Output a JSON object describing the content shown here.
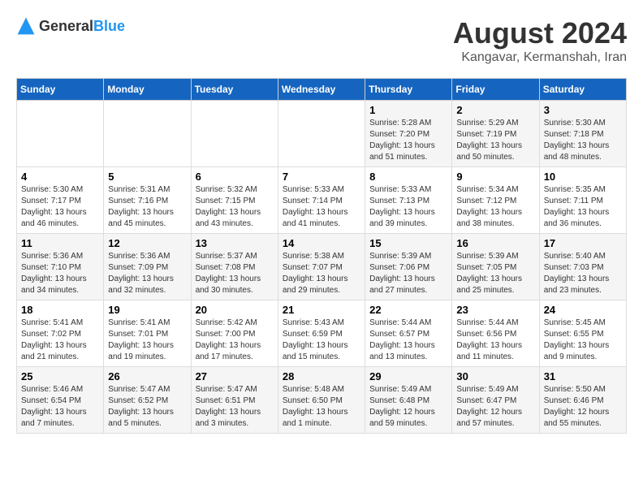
{
  "header": {
    "logo_general": "General",
    "logo_blue": "Blue",
    "title": "August 2024",
    "subtitle": "Kangavar, Kermanshah, Iran"
  },
  "weekdays": [
    "Sunday",
    "Monday",
    "Tuesday",
    "Wednesday",
    "Thursday",
    "Friday",
    "Saturday"
  ],
  "weeks": [
    [
      {
        "day": "",
        "content": ""
      },
      {
        "day": "",
        "content": ""
      },
      {
        "day": "",
        "content": ""
      },
      {
        "day": "",
        "content": ""
      },
      {
        "day": "1",
        "content": "Sunrise: 5:28 AM\nSunset: 7:20 PM\nDaylight: 13 hours and 51 minutes."
      },
      {
        "day": "2",
        "content": "Sunrise: 5:29 AM\nSunset: 7:19 PM\nDaylight: 13 hours and 50 minutes."
      },
      {
        "day": "3",
        "content": "Sunrise: 5:30 AM\nSunset: 7:18 PM\nDaylight: 13 hours and 48 minutes."
      }
    ],
    [
      {
        "day": "4",
        "content": "Sunrise: 5:30 AM\nSunset: 7:17 PM\nDaylight: 13 hours and 46 minutes."
      },
      {
        "day": "5",
        "content": "Sunrise: 5:31 AM\nSunset: 7:16 PM\nDaylight: 13 hours and 45 minutes."
      },
      {
        "day": "6",
        "content": "Sunrise: 5:32 AM\nSunset: 7:15 PM\nDaylight: 13 hours and 43 minutes."
      },
      {
        "day": "7",
        "content": "Sunrise: 5:33 AM\nSunset: 7:14 PM\nDaylight: 13 hours and 41 minutes."
      },
      {
        "day": "8",
        "content": "Sunrise: 5:33 AM\nSunset: 7:13 PM\nDaylight: 13 hours and 39 minutes."
      },
      {
        "day": "9",
        "content": "Sunrise: 5:34 AM\nSunset: 7:12 PM\nDaylight: 13 hours and 38 minutes."
      },
      {
        "day": "10",
        "content": "Sunrise: 5:35 AM\nSunset: 7:11 PM\nDaylight: 13 hours and 36 minutes."
      }
    ],
    [
      {
        "day": "11",
        "content": "Sunrise: 5:36 AM\nSunset: 7:10 PM\nDaylight: 13 hours and 34 minutes."
      },
      {
        "day": "12",
        "content": "Sunrise: 5:36 AM\nSunset: 7:09 PM\nDaylight: 13 hours and 32 minutes."
      },
      {
        "day": "13",
        "content": "Sunrise: 5:37 AM\nSunset: 7:08 PM\nDaylight: 13 hours and 30 minutes."
      },
      {
        "day": "14",
        "content": "Sunrise: 5:38 AM\nSunset: 7:07 PM\nDaylight: 13 hours and 29 minutes."
      },
      {
        "day": "15",
        "content": "Sunrise: 5:39 AM\nSunset: 7:06 PM\nDaylight: 13 hours and 27 minutes."
      },
      {
        "day": "16",
        "content": "Sunrise: 5:39 AM\nSunset: 7:05 PM\nDaylight: 13 hours and 25 minutes."
      },
      {
        "day": "17",
        "content": "Sunrise: 5:40 AM\nSunset: 7:03 PM\nDaylight: 13 hours and 23 minutes."
      }
    ],
    [
      {
        "day": "18",
        "content": "Sunrise: 5:41 AM\nSunset: 7:02 PM\nDaylight: 13 hours and 21 minutes."
      },
      {
        "day": "19",
        "content": "Sunrise: 5:41 AM\nSunset: 7:01 PM\nDaylight: 13 hours and 19 minutes."
      },
      {
        "day": "20",
        "content": "Sunrise: 5:42 AM\nSunset: 7:00 PM\nDaylight: 13 hours and 17 minutes."
      },
      {
        "day": "21",
        "content": "Sunrise: 5:43 AM\nSunset: 6:59 PM\nDaylight: 13 hours and 15 minutes."
      },
      {
        "day": "22",
        "content": "Sunrise: 5:44 AM\nSunset: 6:57 PM\nDaylight: 13 hours and 13 minutes."
      },
      {
        "day": "23",
        "content": "Sunrise: 5:44 AM\nSunset: 6:56 PM\nDaylight: 13 hours and 11 minutes."
      },
      {
        "day": "24",
        "content": "Sunrise: 5:45 AM\nSunset: 6:55 PM\nDaylight: 13 hours and 9 minutes."
      }
    ],
    [
      {
        "day": "25",
        "content": "Sunrise: 5:46 AM\nSunset: 6:54 PM\nDaylight: 13 hours and 7 minutes."
      },
      {
        "day": "26",
        "content": "Sunrise: 5:47 AM\nSunset: 6:52 PM\nDaylight: 13 hours and 5 minutes."
      },
      {
        "day": "27",
        "content": "Sunrise: 5:47 AM\nSunset: 6:51 PM\nDaylight: 13 hours and 3 minutes."
      },
      {
        "day": "28",
        "content": "Sunrise: 5:48 AM\nSunset: 6:50 PM\nDaylight: 13 hours and 1 minute."
      },
      {
        "day": "29",
        "content": "Sunrise: 5:49 AM\nSunset: 6:48 PM\nDaylight: 12 hours and 59 minutes."
      },
      {
        "day": "30",
        "content": "Sunrise: 5:49 AM\nSunset: 6:47 PM\nDaylight: 12 hours and 57 minutes."
      },
      {
        "day": "31",
        "content": "Sunrise: 5:50 AM\nSunset: 6:46 PM\nDaylight: 12 hours and 55 minutes."
      }
    ]
  ]
}
